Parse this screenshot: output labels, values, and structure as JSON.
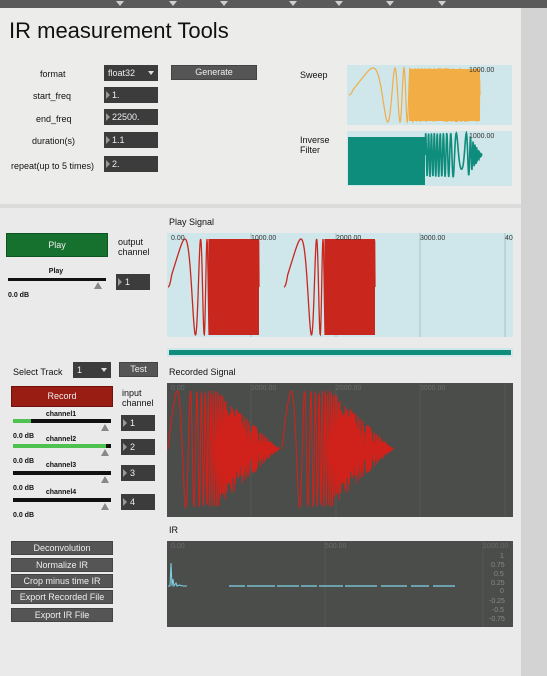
{
  "title": "IR measurement Tools",
  "params": {
    "format_label": "format",
    "format_value": "float32",
    "start_freq_label": "start_freq",
    "start_freq_value": "1.",
    "end_freq_label": "end_freq",
    "end_freq_value": "22500.",
    "duration_label": "duration(s)",
    "duration_value": "1.1",
    "repeat_label": "repeat(up to 5 times)",
    "repeat_value": "2.",
    "generate_label": "Generate"
  },
  "previews": {
    "sweep_label": "Sweep",
    "sweep_tick": "1000.00",
    "inverse_label_1": "Inverse",
    "inverse_label_2": "Filter",
    "inverse_tick": "1000.00"
  },
  "play": {
    "section_title": "Play Signal",
    "play_button": "Play",
    "output_label_1": "output",
    "output_label_2": "channel",
    "gain_label": "Play",
    "gain_db": "0.0 dB",
    "output_channel": "1",
    "ticks": [
      "0.00",
      "1000.00",
      "2000.00",
      "3000.00",
      "40"
    ],
    "progress": 1.0
  },
  "record": {
    "select_track_label": "Select Track",
    "track_value": "1",
    "test_label": "Test",
    "record_button": "Record",
    "input_label_1": "input",
    "input_label_2": "channel",
    "section_title": "Recorded Signal",
    "ticks": [
      "0.00",
      "1000.00",
      "2000.00",
      "3000.00"
    ],
    "channels": [
      {
        "name": "channel1",
        "db": "0.0 dB",
        "input": "1",
        "level": 0.18
      },
      {
        "name": "channel2",
        "db": "0.0 dB",
        "input": "2",
        "level": 0.95
      },
      {
        "name": "channel3",
        "db": "0.0 dB",
        "input": "3",
        "level": 0.0
      },
      {
        "name": "channel4",
        "db": "0.0 dB",
        "input": "4",
        "level": 0.0
      }
    ]
  },
  "ir": {
    "section_title": "IR",
    "ticks": [
      "0.00",
      "500.00",
      "1000.00"
    ],
    "yticks": [
      "1",
      "0.75",
      "0.5",
      "0.25",
      "0",
      "-0.25",
      "-0.5",
      "-0.75"
    ]
  },
  "actions": {
    "deconvolution": "Deconvolution",
    "normalize": "Normalize IR",
    "crop": "Crop minus time IR",
    "export_recorded": "Export Recorded File",
    "export_ir": "Export IR File"
  },
  "colors": {
    "sweep": "#f2ad45",
    "inverse": "#0e8c7c",
    "play_wave": "#c9261d",
    "play_bg": "#cfe6ea",
    "record_wave": "#d0221a",
    "record_bg": "#4b4d4b",
    "ir_line": "#7fd3e6",
    "ir_bg": "#4b4d4b",
    "play_button": "#16702e",
    "record_button": "#9a1d14",
    "progress": "#0e8c7c"
  }
}
